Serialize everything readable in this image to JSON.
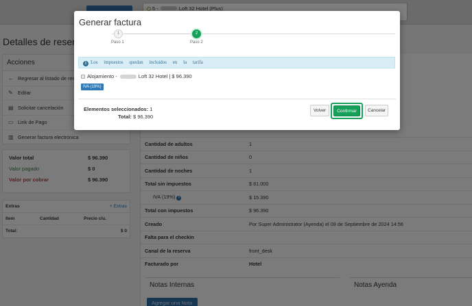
{
  "topbar": {
    "property_selector": {
      "number": "5 -",
      "name": "Loft 32 Hotel (Plus)"
    }
  },
  "page": {
    "heading": "Detalles de reserv"
  },
  "actions": {
    "title": "Acciones",
    "items": [
      {
        "label": "Regresar al listado de res",
        "icon": "arrow-left-icon"
      },
      {
        "label": "Editar",
        "icon": "pencil-icon"
      },
      {
        "label": "Solicitar cancelación",
        "icon": "document-icon"
      },
      {
        "label": "Link de Pago",
        "icon": "credit-card-icon"
      },
      {
        "label": "Generar factura electrónica",
        "icon": "file-icon"
      }
    ]
  },
  "totals": [
    {
      "label": "Valor total",
      "value": "$ 96.390",
      "color": "#333333",
      "bold": true
    },
    {
      "label": "Valor pagado",
      "value": "$ 0",
      "color": "#3c763d",
      "bold": false
    },
    {
      "label": "Valor por cobrar",
      "value": "$ 96.390",
      "color": "#a94442",
      "bold": true
    }
  ],
  "extras": {
    "title": "Extras",
    "add_label": "+ Extras",
    "columns": [
      "Item",
      "Cantidad",
      "Precio c/u."
    ],
    "total_label": "Total:",
    "total_value": "$ 0"
  },
  "details": {
    "rows": [
      {
        "label": "Cantidad de adultos",
        "value": "1"
      },
      {
        "label": "Cantidad de niños",
        "value": "0"
      },
      {
        "label": "Cantidad de noches",
        "value": "1"
      },
      {
        "label": "Total sin impuestos",
        "value": "$ 81.000"
      },
      {
        "label": "IVA (19%)",
        "value": "$ 15.390",
        "sub": true
      },
      {
        "label": "Total con impuestos",
        "value": "$ 96.390"
      },
      {
        "label": "Creado",
        "value": "Por Super Administrator (Ayenda) el 09 de Septiembre de 2024 14:56"
      },
      {
        "label": "Falta para el checkin",
        "value": ""
      },
      {
        "label": "Canal de la reserva",
        "value": "front_desk"
      },
      {
        "label": "Facturado por",
        "value": "Hotel",
        "value_bold": true
      }
    ],
    "notes_internal_title": "Notas Internas",
    "notes_ayenda_title": "Notas Ayenda",
    "add_note_label": "Agregar una Nota"
  },
  "modal": {
    "title": "Generar factura",
    "steps": [
      {
        "number": "1",
        "label": "Paso 1",
        "active": false
      },
      {
        "number": "2",
        "label": "Paso 2",
        "active": true
      }
    ],
    "info_text": "Los impuestos quedan incluidos en la tarifa",
    "item": {
      "prefix": "Alojamiento -",
      "suffix": "Loft 32 Hotel | $ 96.390"
    },
    "tax_badge": "IVA (19%)",
    "summary": {
      "selected_label": "Elementos seleccionados:",
      "selected_value": "1",
      "total_label": "Total:",
      "total_value": "$ 96.390"
    },
    "buttons": {
      "back": "Volver",
      "confirm": "Confirmar",
      "cancel": "Cancelar"
    },
    "accent_color": "#16a05a"
  }
}
